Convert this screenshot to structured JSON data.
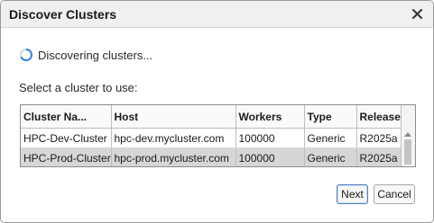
{
  "dialog": {
    "title": "Discover Clusters",
    "close_icon": "close-icon"
  },
  "status": {
    "text": "Discovering clusters...",
    "icon": "spinner-icon"
  },
  "select_label": "Select a cluster to use:",
  "table": {
    "columns": [
      "Cluster Na...",
      "Host",
      "Workers",
      "Type",
      "Release"
    ],
    "rows": [
      [
        "HPC-Dev-Cluster",
        "hpc-dev.mycluster.com",
        "100000",
        "Generic",
        "R2025a"
      ],
      [
        "HPC-Prod-Cluster",
        "hpc-prod.mycluster.com",
        "100000",
        "Generic",
        "R2025a"
      ]
    ],
    "selected_row": 1
  },
  "buttons": {
    "next": "Next",
    "cancel": "Cancel"
  },
  "colors": {
    "selected_row": "#d6d6d6",
    "spinner": "#2f80ed",
    "default_button_border": "#4a7fc1"
  }
}
